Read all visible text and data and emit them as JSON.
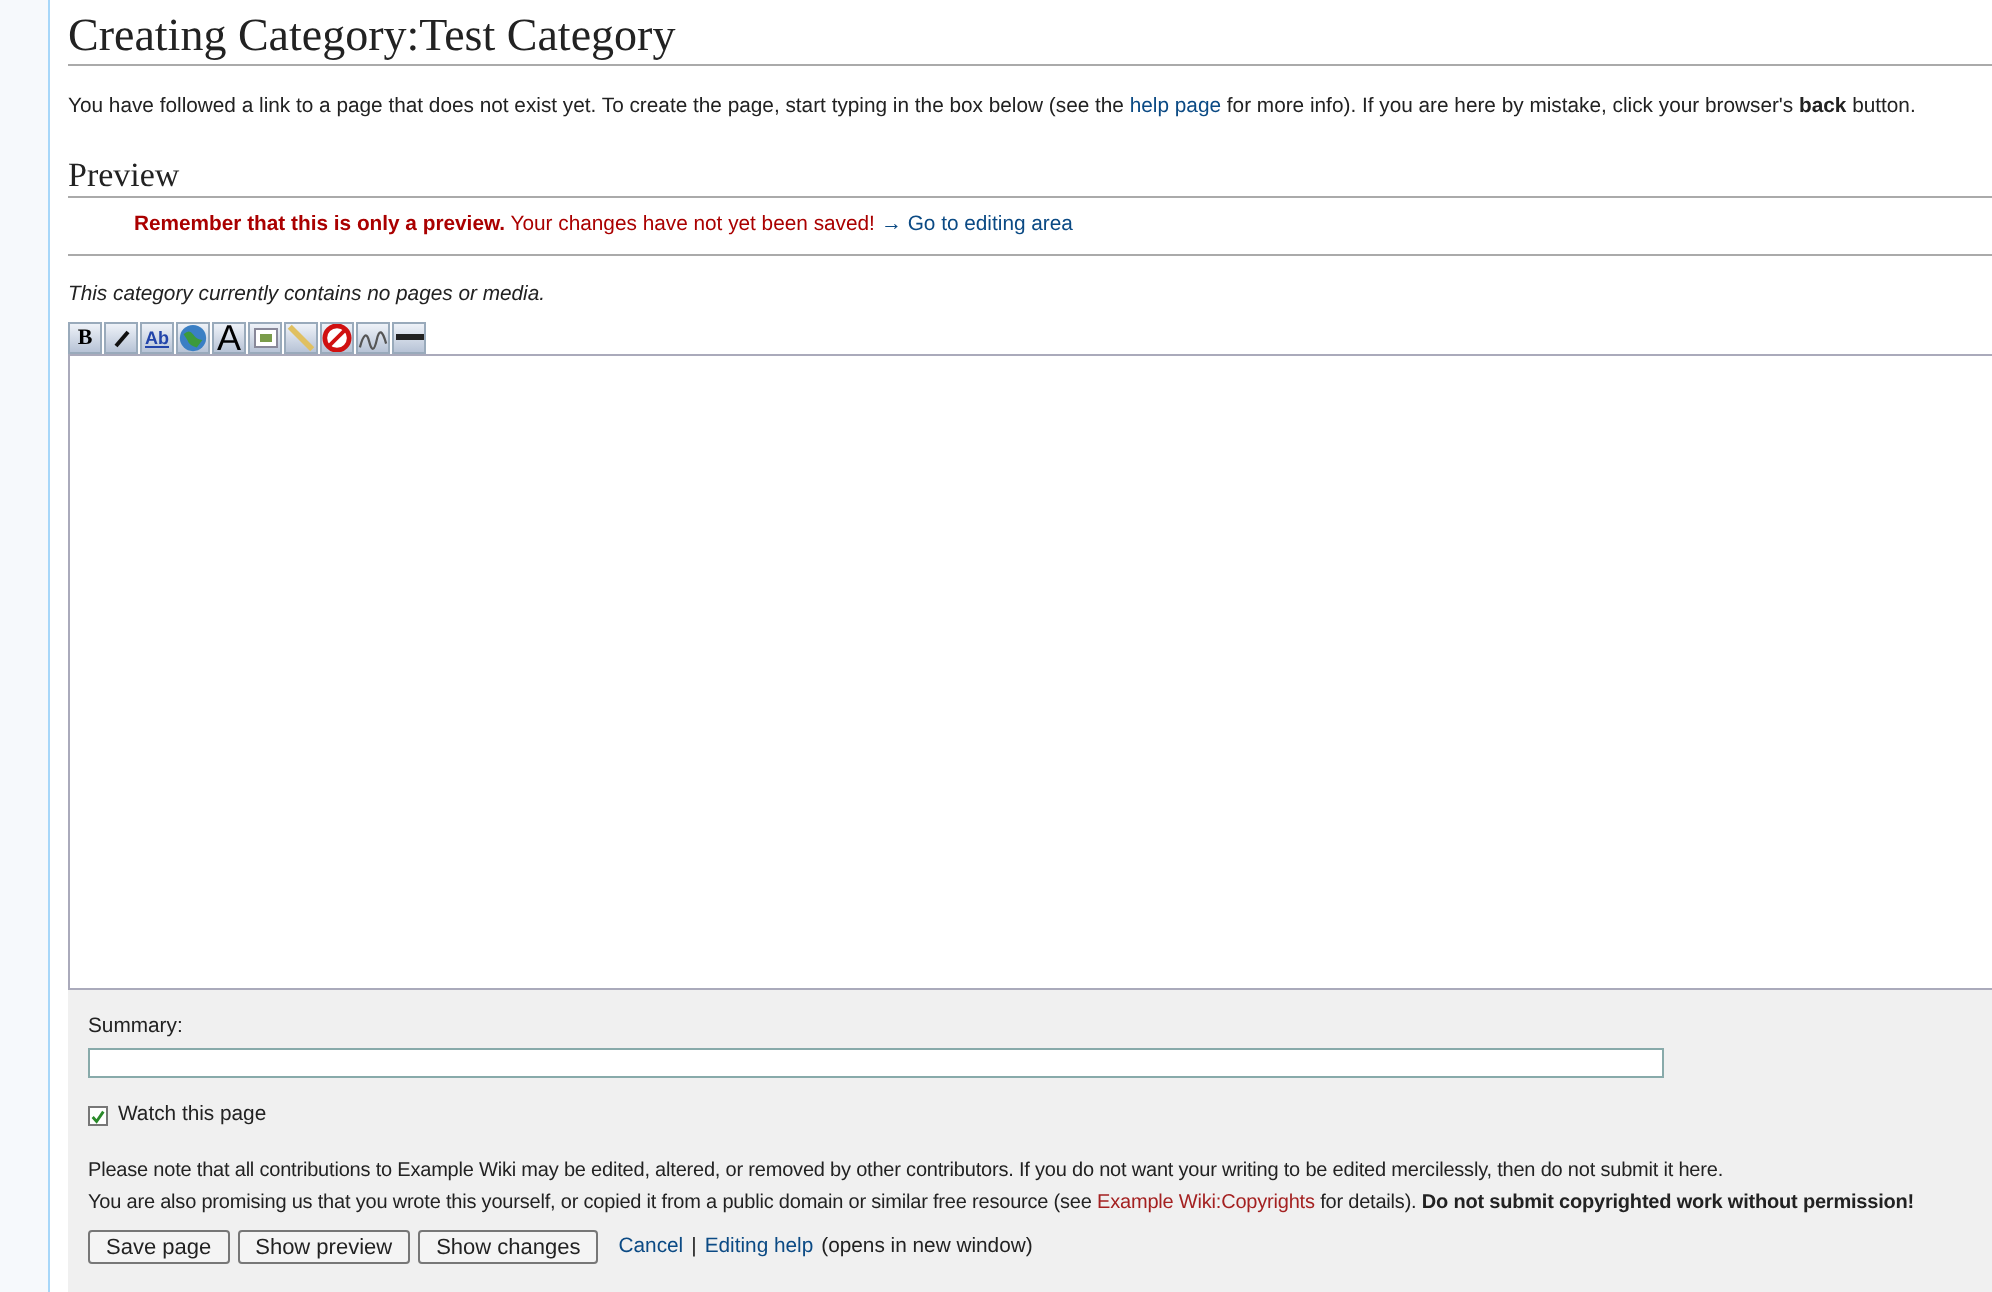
{
  "title": "Creating Category:Test Category",
  "intro": {
    "before": "You have followed a link to a page that does not exist yet. To create the page, start typing in the box below (see the ",
    "link": "help page",
    "after": " for more info). If you are here by mistake, click your browser's **back** button."
  },
  "preview": {
    "heading": "Preview",
    "warning_strong": "Remember that this is only a preview.",
    "warning_rest": "Your changes have not yet been saved!",
    "arrow": "→",
    "goto_link": "Go to editing area",
    "category_note": "This category currently contains no pages or media."
  },
  "toolbar": [
    {
      "kind": "bold",
      "glyph": "B"
    },
    {
      "kind": "italic"
    },
    {
      "kind": "link",
      "glyph": "Ab"
    },
    {
      "kind": "globe"
    },
    {
      "kind": "headline",
      "glyph": "A"
    },
    {
      "kind": "image"
    },
    {
      "kind": "media"
    },
    {
      "kind": "nowiki"
    },
    {
      "kind": "signature"
    },
    {
      "kind": "rule"
    }
  ],
  "summary": {
    "label": "Summary:"
  },
  "watch": {
    "label": "Watch this page",
    "checked": true
  },
  "notice": {
    "line1": "Please note that all contributions to Example Wiki may be edited, altered, or removed by other contributors. If you do not want your writing to be edited mercilessly, then do not submit it here.",
    "line2_before": "You are also promising us that you wrote this yourself, or copied it from a public domain or similar free resource (see ",
    "line2_link": "Example Wiki:Copyrights",
    "line2_after": " for details). **Do not submit copyrighted work without permission!**"
  },
  "buttons": [
    "Save page",
    "Show preview",
    "Show changes"
  ],
  "links": {
    "cancel": "Cancel",
    "separator": "|",
    "help": "Editing help",
    "help_note": "(opens in new window)"
  }
}
